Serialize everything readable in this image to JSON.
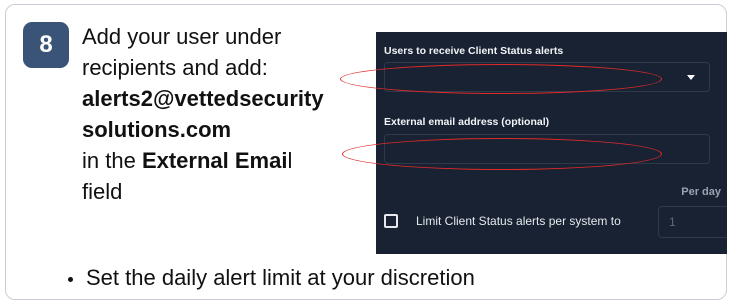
{
  "step": {
    "number": "8"
  },
  "instructions": {
    "line1": "Add your user under",
    "line2": "recipients and add:",
    "email_part1": "alerts2@vettedsecurity",
    "email_part2": "solutions.com",
    "line5_prefix": "in the ",
    "line5_bold": "External Emai",
    "line5_suffix": "l",
    "line6": "field"
  },
  "screenshot": {
    "recipients_label": "Users to receive Client Status alerts",
    "recipients_value": "",
    "external_email_label": "External email address (optional)",
    "external_email_value": "",
    "per_day_label": "Per day",
    "limit_checkbox_label": "Limit Client Status alerts per system to",
    "limit_checkbox_checked": false,
    "per_day_placeholder": "1"
  },
  "bullet": {
    "text": "Set the daily alert limit at your discretion"
  },
  "colors": {
    "badge": "#3a5478",
    "screenshot_bg": "#182232",
    "highlight_ellipse": "#e02a2a",
    "card_border": "#c9ced6"
  },
  "icons": {
    "dropdown": "chevron-down-icon",
    "checkbox": "checkbox-unchecked-icon"
  }
}
